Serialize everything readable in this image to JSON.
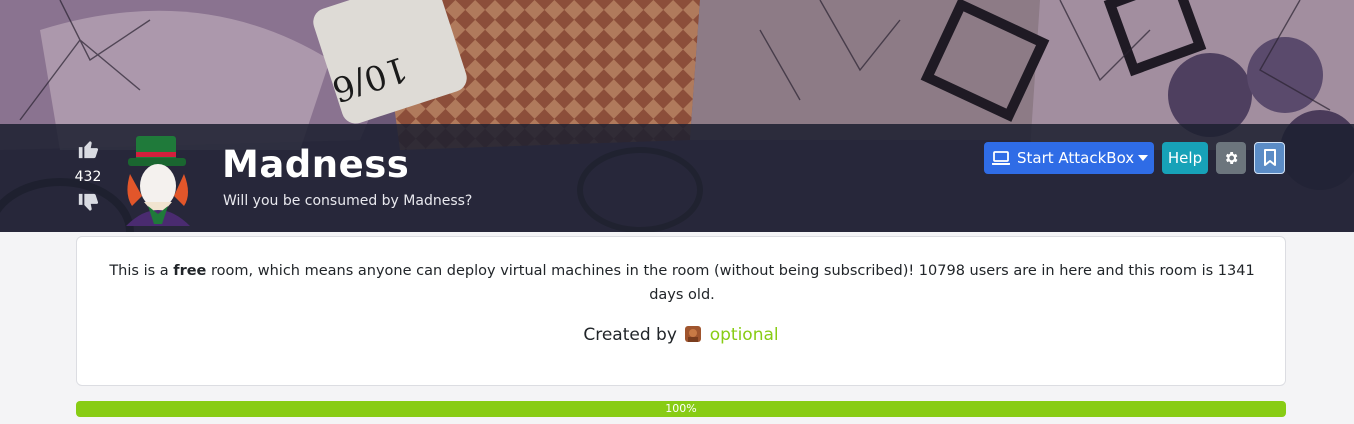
{
  "room": {
    "title": "Madness",
    "subtitle": "Will you be consumed by Madness?",
    "votes": "432"
  },
  "buttons": {
    "start_attackbox": "Start AttackBox",
    "help": "Help"
  },
  "info": {
    "prefix": "This is a ",
    "free_word": "free",
    "suffix": " room, which means anyone can deploy virtual machines in the room (without being subscribed)! 10798 users are in here and this room is 1341 days old."
  },
  "creator": {
    "label": "Created by",
    "username": "optional"
  },
  "progress": {
    "value": 100,
    "label": "100%"
  },
  "icons": {
    "upvote": "thumbs-up-icon",
    "downvote": "thumbs-down-icon",
    "attackbox": "laptop-icon",
    "dropdown": "caret-down-icon",
    "settings": "gear-icon",
    "bookmark": "bookmark-icon"
  },
  "colors": {
    "primary": "#2f6ce6",
    "help": "#17a2b8",
    "settings": "#6c757d",
    "success": "#88cc14",
    "banner_bar": "#1c2030"
  }
}
